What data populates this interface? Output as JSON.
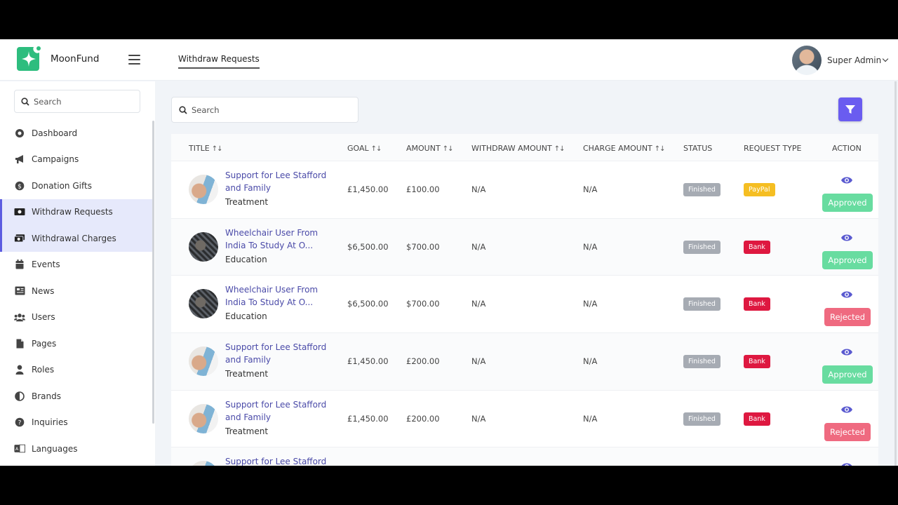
{
  "brand": {
    "name": "MoonFund"
  },
  "header": {
    "tab": "Withdraw Requests",
    "user": "Super Admin"
  },
  "sidebar": {
    "search_placeholder": "Search",
    "items": [
      {
        "label": "Dashboard",
        "icon": "dashboard-icon"
      },
      {
        "label": "Campaigns",
        "icon": "megaphone-icon"
      },
      {
        "label": "Donation Gifts",
        "icon": "dollar-coin-icon"
      },
      {
        "label": "Withdraw Requests",
        "icon": "money-icon"
      },
      {
        "label": "Withdrawal Charges",
        "icon": "money-stack-icon"
      },
      {
        "label": "Events",
        "icon": "calendar-icon"
      },
      {
        "label": "News",
        "icon": "newspaper-icon"
      },
      {
        "label": "Users",
        "icon": "users-icon"
      },
      {
        "label": "Pages",
        "icon": "pages-icon"
      },
      {
        "label": "Roles",
        "icon": "user-icon"
      },
      {
        "label": "Brands",
        "icon": "half-circle-icon"
      },
      {
        "label": "Inquiries",
        "icon": "question-icon"
      },
      {
        "label": "Languages",
        "icon": "language-icon"
      }
    ]
  },
  "main": {
    "search_placeholder": "Search",
    "columns": {
      "title": "TITLE",
      "goal": "GOAL",
      "amount": "AMOUNT",
      "withdraw_amount": "WITHDRAW AMOUNT",
      "charge_amount": "CHARGE AMOUNT",
      "status": "STATUS",
      "request_type": "REQUEST TYPE",
      "action": "ACTION"
    },
    "sort_glyph": "↑↓",
    "rows": [
      {
        "title1": "Support for Lee Stafford",
        "title2": "and Family",
        "category": "Treatment",
        "goal": "£1,450.00",
        "amount": "£100.00",
        "withdraw": "N/A",
        "charge": "N/A",
        "status": "Finished",
        "type": "PayPal",
        "action": "Approved"
      },
      {
        "title1": "Wheelchair User From",
        "title2": "India To Study At O...",
        "category": "Education",
        "goal": "$6,500.00",
        "amount": "$700.00",
        "withdraw": "N/A",
        "charge": "N/A",
        "status": "Finished",
        "type": "Bank",
        "action": "Approved"
      },
      {
        "title1": "Wheelchair User From",
        "title2": "India To Study At O...",
        "category": "Education",
        "goal": "$6,500.00",
        "amount": "$700.00",
        "withdraw": "N/A",
        "charge": "N/A",
        "status": "Finished",
        "type": "Bank",
        "action": "Rejected"
      },
      {
        "title1": "Support for Lee Stafford",
        "title2": "and Family",
        "category": "Treatment",
        "goal": "£1,450.00",
        "amount": "£200.00",
        "withdraw": "N/A",
        "charge": "N/A",
        "status": "Finished",
        "type": "Bank",
        "action": "Approved"
      },
      {
        "title1": "Support for Lee Stafford",
        "title2": "and Family",
        "category": "Treatment",
        "goal": "£1,450.00",
        "amount": "£200.00",
        "withdraw": "N/A",
        "charge": "N/A",
        "status": "Finished",
        "type": "Bank",
        "action": "Rejected"
      },
      {
        "title1": "Support for Lee Stafford"
      }
    ]
  },
  "colors": {
    "accent": "#6a5cf0",
    "link": "#4a4aa8",
    "approved": "#68dca0",
    "rejected": "#ef6a80",
    "bank": "#de1840",
    "paypal": "#f5be22",
    "finished": "#a6abb3",
    "brand": "#2dbd7e"
  }
}
